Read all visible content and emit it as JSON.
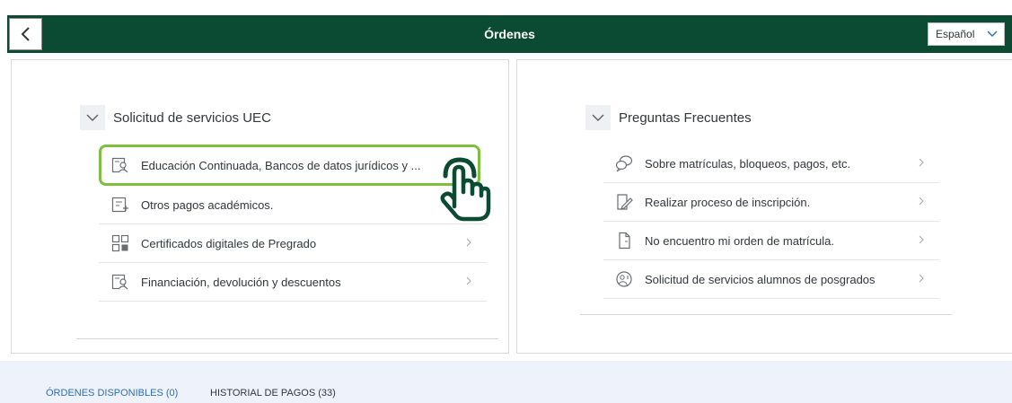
{
  "header": {
    "title": "Órdenes",
    "language": "Español"
  },
  "left_group": {
    "title": "Solicitud de servicios UEC",
    "items": [
      {
        "label": "Educación Continuada, Bancos de datos jurídicos y ...",
        "icon": "person-card-icon",
        "highlighted": true
      },
      {
        "label": "Otros pagos académicos.",
        "icon": "checklist-add-icon"
      },
      {
        "label": "Certificados digitales de Pregrado",
        "icon": "certificate-grid-icon"
      },
      {
        "label": "Financiación, devolución y descuentos",
        "icon": "person-card-icon"
      }
    ]
  },
  "right_group": {
    "title": "Preguntas Frecuentes",
    "items": [
      {
        "label": "Sobre matrículas, bloqueos, pagos, etc.",
        "icon": "chat-bubbles-icon"
      },
      {
        "label": "Realizar proceso de inscripción.",
        "icon": "edit-form-icon"
      },
      {
        "label": "No encuentro mi orden de matrícula.",
        "icon": "document-icon"
      },
      {
        "label": "Solicitud de servicios alumnos de posgrados",
        "icon": "service-globe-icon"
      }
    ]
  },
  "tabs": [
    {
      "label": "ÓRDENES DISPONIBLES (0)",
      "active": true
    },
    {
      "label": "HISTORIAL DE PAGOS (33)",
      "active": false
    }
  ],
  "colors": {
    "header_bg": "#0b4a33",
    "highlight_border": "#7fbf3f",
    "active_tab": "#2c6eb5",
    "pointer_hand": "#0b4a33"
  }
}
